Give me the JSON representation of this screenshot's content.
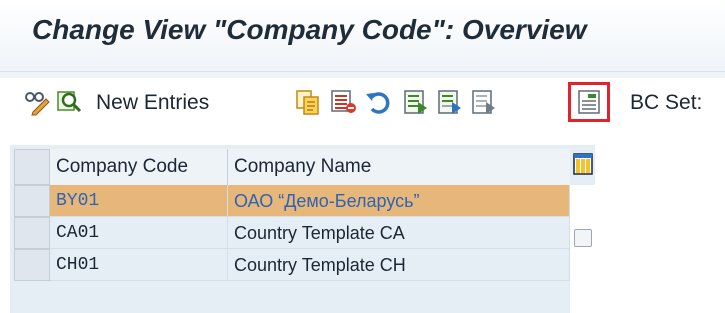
{
  "title": "Change View \"Company Code\": Overview",
  "toolbar": {
    "new_entries_label": "New Entries",
    "bc_set_label": "BC Set:",
    "icons": [
      "display-change-icon",
      "find-icon",
      "copy-as-icon",
      "delete-icon",
      "undo-icon",
      "select-all-icon",
      "select-block-icon",
      "deselect-all-icon",
      "detail-icon"
    ]
  },
  "table": {
    "columns": [
      "Company Code",
      "Company Name"
    ],
    "rows": [
      {
        "code": "BY01",
        "name": "ОАО “Демо-Беларусь”",
        "selected": true
      },
      {
        "code": "CA01",
        "name": "Country Template CA",
        "selected": false
      },
      {
        "code": "CH01",
        "name": "Country Template CH",
        "selected": false
      }
    ]
  },
  "colors": {
    "selected_row": "#e7b77a",
    "highlight": "#e0232d",
    "link_text": "#2e63b5"
  }
}
